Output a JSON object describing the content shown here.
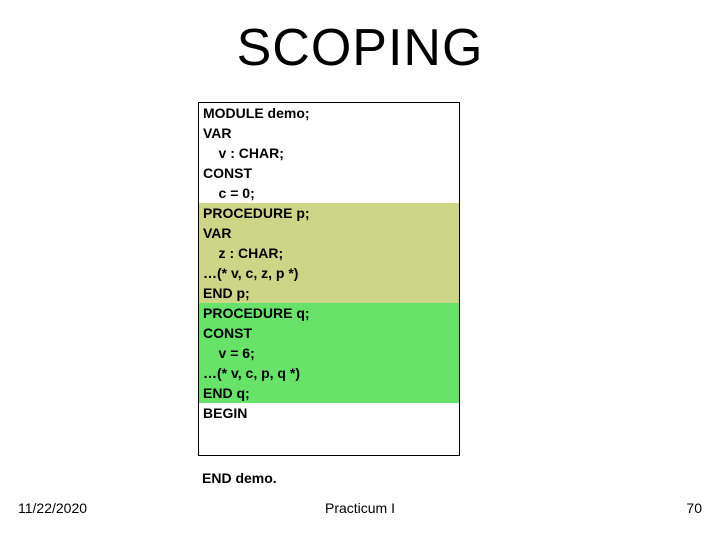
{
  "title": "SCOPING",
  "code": {
    "l1": "MODULE demo;",
    "l2": "VAR",
    "l3": "    v : CHAR;",
    "l4": "CONST",
    "l5": "    c = 0;",
    "l6": "PROCEDURE p;",
    "l7": "VAR",
    "l8": "    z : CHAR;",
    "l9": "…(* v, c, z, p *)",
    "l10": "END p;",
    "l11": "PROCEDURE q;",
    "l12": "CONST",
    "l13": "    v = 6;",
    "l14": "…(* v, c, p, q *)",
    "l15": "END q;",
    "l16": "BEGIN",
    "l17": "END demo."
  },
  "footer": {
    "date": "11/22/2020",
    "center": "Practicum I",
    "page": "70"
  }
}
